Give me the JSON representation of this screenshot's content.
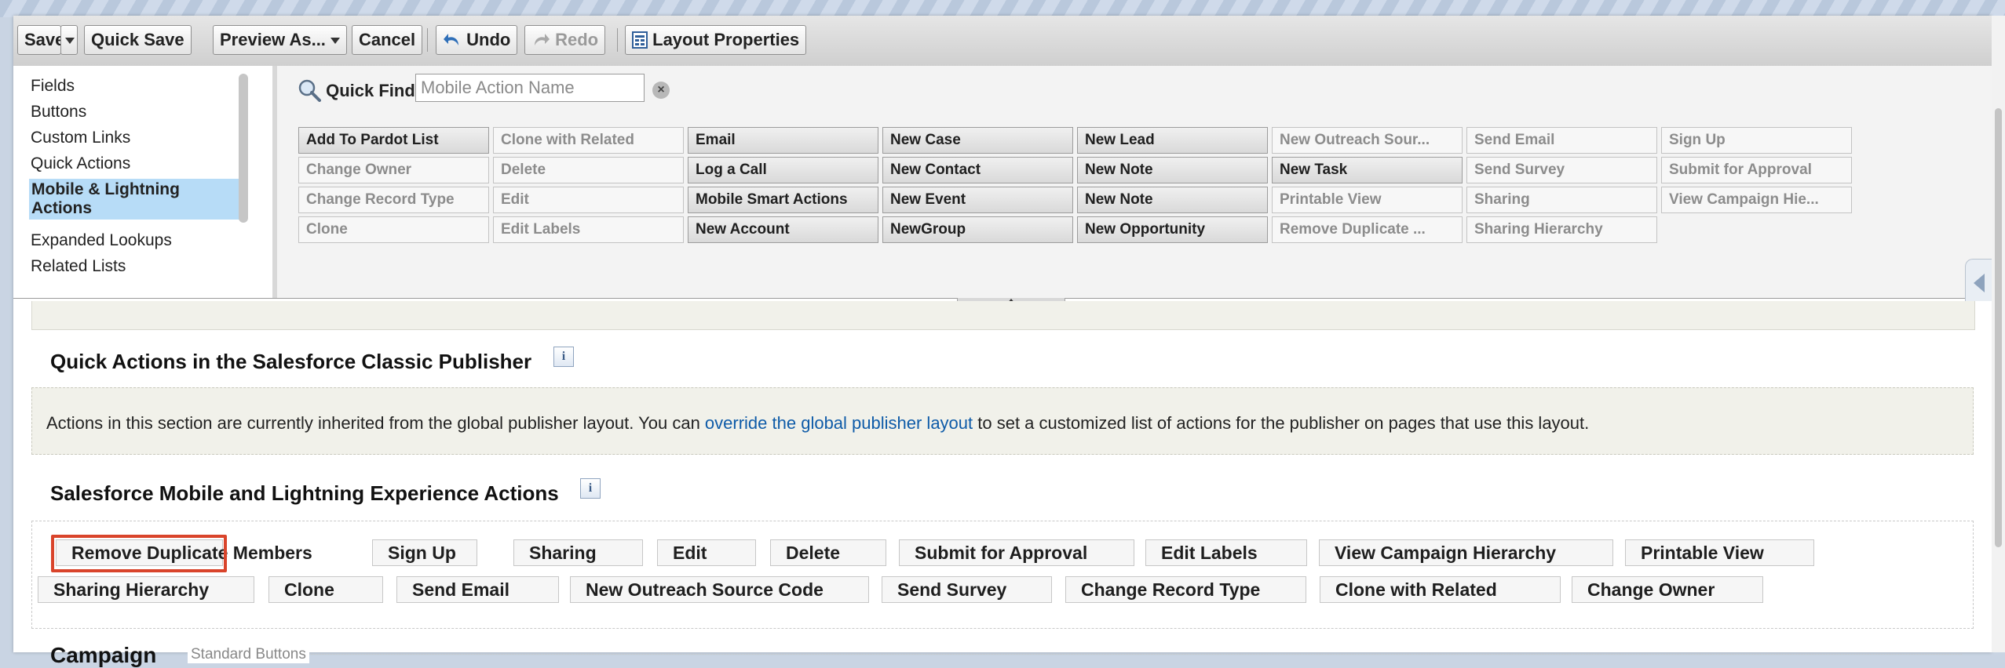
{
  "toolbar": {
    "save": "Save",
    "quick_save": "Quick Save",
    "preview_as": "Preview As...",
    "cancel": "Cancel",
    "undo": "Undo",
    "redo": "Redo",
    "layout_properties": "Layout Properties"
  },
  "palette": {
    "nav_items": [
      "Fields",
      "Buttons",
      "Custom Links",
      "Quick Actions",
      "Mobile & Lightning Actions",
      "Expanded Lookups",
      "Related Lists"
    ],
    "selected_nav": "Mobile & Lightning Actions",
    "quick_find_label": "Quick Find",
    "quick_find_placeholder": "Mobile Action Name",
    "items": [
      [
        "Add To Pardot List",
        "Change Owner",
        "Change Record Type",
        "Clone"
      ],
      [
        "Clone with Related",
        "Delete",
        "Edit",
        "Edit Labels"
      ],
      [
        "Email",
        "Log a Call",
        "Mobile Smart Actions",
        "New Account"
      ],
      [
        "New Case",
        "New Contact",
        "New Event",
        "NewGroup"
      ],
      [
        "New Lead",
        "New Note",
        "New Note",
        "New Opportunity"
      ],
      [
        "New Outreach Sour...",
        "New Task",
        "Printable View",
        "Remove Duplicate ..."
      ],
      [
        "Send Email",
        "Send Survey",
        "Sharing",
        "Sharing Hierarchy"
      ],
      [
        "Sign Up",
        "Submit for Approval",
        "View Campaign Hie..."
      ]
    ]
  },
  "classic": {
    "title": "Quick Actions in the Salesforce Classic Publisher",
    "message_pre": "Actions in this section are currently inherited from the global publisher layout. You can ",
    "message_link": "override the global publisher layout",
    "message_post": " to set a customized list of actions for the publisher on pages that use this layout."
  },
  "mobile": {
    "title": "Salesforce Mobile and Lightning Experience Actions",
    "row1": [
      "Remove Duplicate Members",
      "Sign Up",
      "Sharing",
      "Edit",
      "Delete",
      "Submit for Approval",
      "Edit Labels",
      "View Campaign Hierarchy",
      "Printable View"
    ],
    "row2": [
      "Sharing Hierarchy",
      "Clone",
      "Send Email",
      "New Outreach Source Code",
      "Send Survey",
      "Change Record Type",
      "Clone with Related",
      "Change Owner"
    ]
  },
  "section": {
    "campaign": "Campaign",
    "standard_buttons": "Standard Buttons"
  },
  "colors": {
    "highlight": "#d9442b",
    "link": "#0e5ba8",
    "selected_nav_bg": "#b7dcf7"
  }
}
